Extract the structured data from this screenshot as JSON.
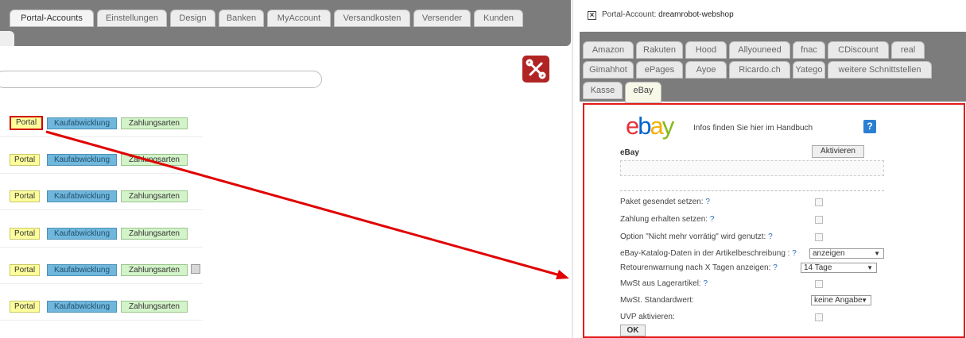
{
  "left": {
    "tabs": [
      "Portal-Accounts",
      "Einstellungen",
      "Design",
      "Banken",
      "MyAccount",
      "Versandkosten",
      "Versender",
      "Kunden"
    ],
    "active_tab": "Portal-Accounts",
    "row_buttons": {
      "portal": "Portal",
      "kauf": "Kaufabwicklung",
      "zahlung": "Zahlungsarten"
    },
    "colors": {
      "tabbar": "#7c7c7c",
      "portal": "#fdfd9c",
      "kauf": "#6fb7dc",
      "zahlung": "#d3f3c9",
      "highlight": "#d20000"
    }
  },
  "right": {
    "account_prefix": "Portal-Account:",
    "account_name": "dreamrobot-webshop",
    "tabs_row1": [
      "Amazon",
      "Rakuten",
      "Hood",
      "Allyouneed",
      "fnac",
      "CDiscount",
      "real"
    ],
    "tabs_row2": [
      "Gimahhot",
      "ePages",
      "Ayoe",
      "Ricardo.ch",
      "Yatego",
      "weitere Schnittstellen"
    ],
    "tabs_row3": [
      "Kasse",
      "eBay"
    ],
    "active_tab": "eBay",
    "logo_text": [
      "e",
      "b",
      "a",
      "y"
    ],
    "info_text": "Infos finden Sie hier im Handbuch",
    "help_glyph": "?",
    "ebay_label": "eBay",
    "activate_label": "Aktivieren",
    "options": [
      {
        "label": "Paket gesendet setzen:",
        "help": "?",
        "control": "checkbox"
      },
      {
        "label": "Zahlung erhalten setzen:",
        "help": "?",
        "control": "checkbox"
      },
      {
        "label": "Option \"Nicht mehr vorrätig\" wird genutzt:",
        "help": "?",
        "control": "checkbox"
      },
      {
        "label": "eBay-Katalog-Daten in der Artikelbeschreibung :",
        "help": "?",
        "control": "select",
        "value": "anzeigen"
      },
      {
        "label": "Retourenwarnung nach X Tagen anzeigen:",
        "help": "?",
        "control": "select",
        "value": "14 Tage"
      },
      {
        "label": "MwSt aus Lagerartikel:",
        "help": "?",
        "control": "checkbox"
      },
      {
        "label": "MwSt. Standardwert:",
        "help": "",
        "control": "select",
        "value": "keine Angabe"
      },
      {
        "label": "UVP aktivieren:",
        "help": "",
        "control": "checkbox"
      }
    ],
    "ok_label": "OK",
    "select_arrow": "▼",
    "colors": {
      "ebay_e": "#e53238",
      "ebay_b": "#0064d2",
      "ebay_a": "#f5af02",
      "ebay_y": "#86b817",
      "frame": "#e21b1b"
    }
  }
}
